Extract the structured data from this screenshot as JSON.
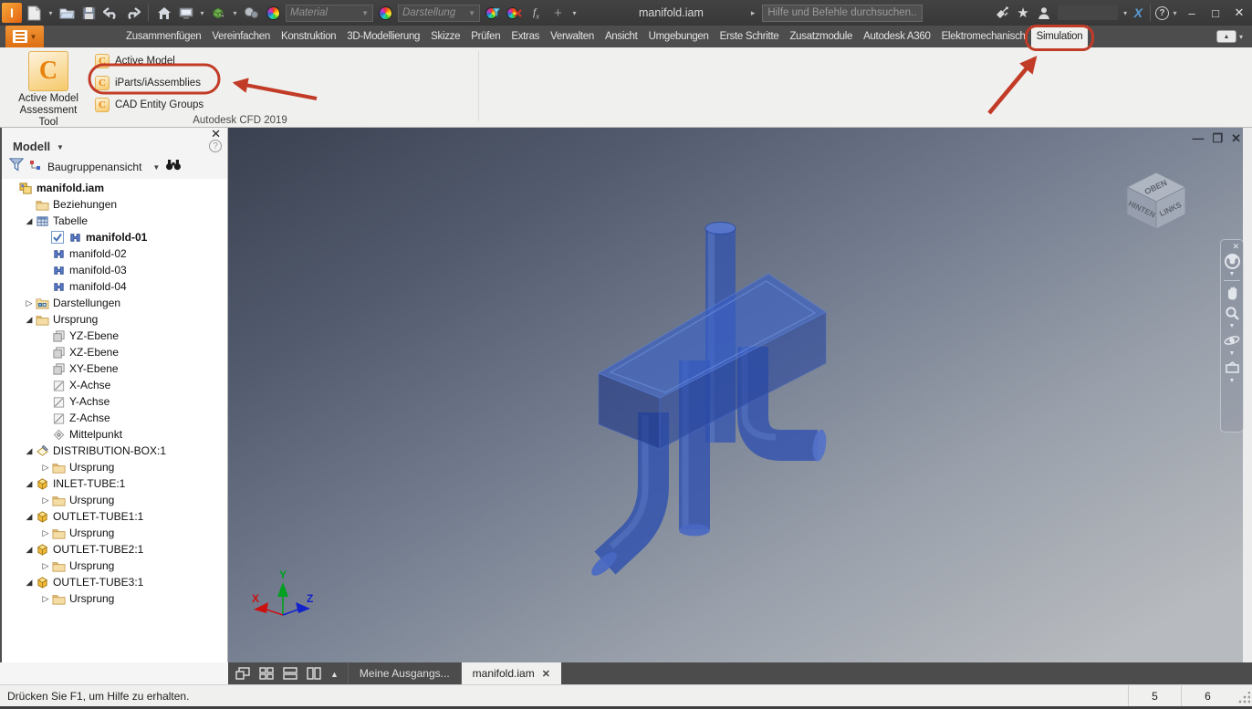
{
  "titlebar": {
    "toolbar_icons": [
      "inventor-logo",
      "new-file",
      "caret",
      "open-folder",
      "save",
      "undo",
      "redo",
      "separator",
      "home",
      "view-face",
      "caret",
      "component-box",
      "caret",
      "material-spheres",
      "appearance-wheel"
    ],
    "material_combo": "Material",
    "darstellung_combo": "Darstellung",
    "post_combo_icons": [
      "appearance-wheel",
      "wheel-filter",
      "wheel-clear",
      "fx",
      "plus",
      "caret"
    ],
    "document_title": "manifold.iam",
    "search_placeholder": "Hilfe und Befehle durchsuchen..",
    "right_icons": [
      "satellite",
      "favorites-star",
      "user",
      "signin-area",
      "caret",
      "exchange-x",
      "separator",
      "help",
      "caret"
    ],
    "window_buttons": [
      "minimize",
      "maximize",
      "close"
    ]
  },
  "ribbon": {
    "tabs": [
      "Zusammenfügen",
      "Vereinfachen",
      "Konstruktion",
      "3D-Modellierung",
      "Skizze",
      "Prüfen",
      "Extras",
      "Verwalten",
      "Ansicht",
      "Umgebungen",
      "Erste Schritte",
      "Zusatzmodule",
      "Autodesk A360",
      "Elektromechanisch",
      "Simulation"
    ],
    "active_tab": "Simulation",
    "panel": {
      "big_button_line1": "Active Model",
      "big_button_line2": "Assessment Tool",
      "buttons": [
        "Active Model",
        "iParts/iAssemblies",
        "CAD Entity Groups"
      ],
      "annotated_button": "iParts/iAssemblies",
      "label": "Autodesk CFD 2019"
    }
  },
  "browser": {
    "panel_title": "Modell",
    "view_mode": "Baugruppenansicht",
    "tree": [
      {
        "label": "manifold.iam",
        "level": 0,
        "icon": "assembly",
        "expander": "none",
        "bold": true
      },
      {
        "label": "Beziehungen",
        "level": 1,
        "icon": "folder",
        "expander": "none"
      },
      {
        "label": "Tabelle",
        "level": 1,
        "icon": "table",
        "expander": "open"
      },
      {
        "label": "manifold-01",
        "level": 2,
        "icon": "part",
        "expander": "none",
        "bold": true,
        "checkbox": true
      },
      {
        "label": "manifold-02",
        "level": 2,
        "icon": "part",
        "expander": "none"
      },
      {
        "label": "manifold-03",
        "level": 2,
        "icon": "part",
        "expander": "none"
      },
      {
        "label": "manifold-04",
        "level": 2,
        "icon": "part",
        "expander": "none"
      },
      {
        "label": "Darstellungen",
        "level": 1,
        "icon": "views",
        "expander": "closed"
      },
      {
        "label": "Ursprung",
        "level": 1,
        "icon": "folder",
        "expander": "open"
      },
      {
        "label": "YZ-Ebene",
        "level": 2,
        "icon": "plane",
        "expander": "none"
      },
      {
        "label": "XZ-Ebene",
        "level": 2,
        "icon": "plane",
        "expander": "none"
      },
      {
        "label": "XY-Ebene",
        "level": 2,
        "icon": "plane",
        "expander": "none"
      },
      {
        "label": "X-Achse",
        "level": 2,
        "icon": "axis",
        "expander": "none"
      },
      {
        "label": "Y-Achse",
        "level": 2,
        "icon": "axis",
        "expander": "none"
      },
      {
        "label": "Z-Achse",
        "level": 2,
        "icon": "axis",
        "expander": "none"
      },
      {
        "label": "Mittelpunkt",
        "level": 2,
        "icon": "center",
        "expander": "none"
      },
      {
        "label": "DISTRIBUTION-BOX:1",
        "level": 1,
        "icon": "partsketch",
        "expander": "open"
      },
      {
        "label": "Ursprung",
        "level": 2,
        "icon": "folder",
        "expander": "closed"
      },
      {
        "label": "INLET-TUBE:1",
        "level": 1,
        "icon": "partbox",
        "expander": "open"
      },
      {
        "label": "Ursprung",
        "level": 2,
        "icon": "folder",
        "expander": "closed"
      },
      {
        "label": "OUTLET-TUBE1:1",
        "level": 1,
        "icon": "partbox",
        "expander": "open"
      },
      {
        "label": "Ursprung",
        "level": 2,
        "icon": "folder",
        "expander": "closed"
      },
      {
        "label": "OUTLET-TUBE2:1",
        "level": 1,
        "icon": "partbox",
        "expander": "open"
      },
      {
        "label": "Ursprung",
        "level": 2,
        "icon": "folder",
        "expander": "closed"
      },
      {
        "label": "OUTLET-TUBE3:1",
        "level": 1,
        "icon": "partbox",
        "expander": "open"
      },
      {
        "label": "Ursprung",
        "level": 2,
        "icon": "folder",
        "expander": "closed"
      }
    ]
  },
  "viewport": {
    "viewcube": {
      "top": "OBEN",
      "left": "HINTEN",
      "right": "LINKS"
    },
    "triad": {
      "x": "X",
      "y": "Y",
      "z": "Z"
    },
    "nav_icons": [
      "close",
      "nav-wheel",
      "caret",
      "pan-hand",
      "zoom-magnifier",
      "caret",
      "orbit",
      "caret",
      "look-at",
      "caret"
    ],
    "mdi_buttons": [
      "minimize",
      "restore",
      "close"
    ],
    "model_color": "#2f54ad"
  },
  "doctabs": {
    "window_icons": [
      "cascade-windows",
      "tile-windows",
      "split-horizontal",
      "split-vertical",
      "expand-up"
    ],
    "tabs": [
      {
        "label": "Meine Ausgangs...",
        "active": false,
        "closable": false
      },
      {
        "label": "manifold.iam",
        "active": true,
        "closable": true
      }
    ]
  },
  "statusbar": {
    "message": "Drücken Sie F1, um Hilfe zu erhalten.",
    "cells": [
      "5",
      "6"
    ]
  },
  "annotations": {
    "color": "#c23b27",
    "circled": [
      "iParts/iAssemblies",
      "Simulation"
    ]
  }
}
